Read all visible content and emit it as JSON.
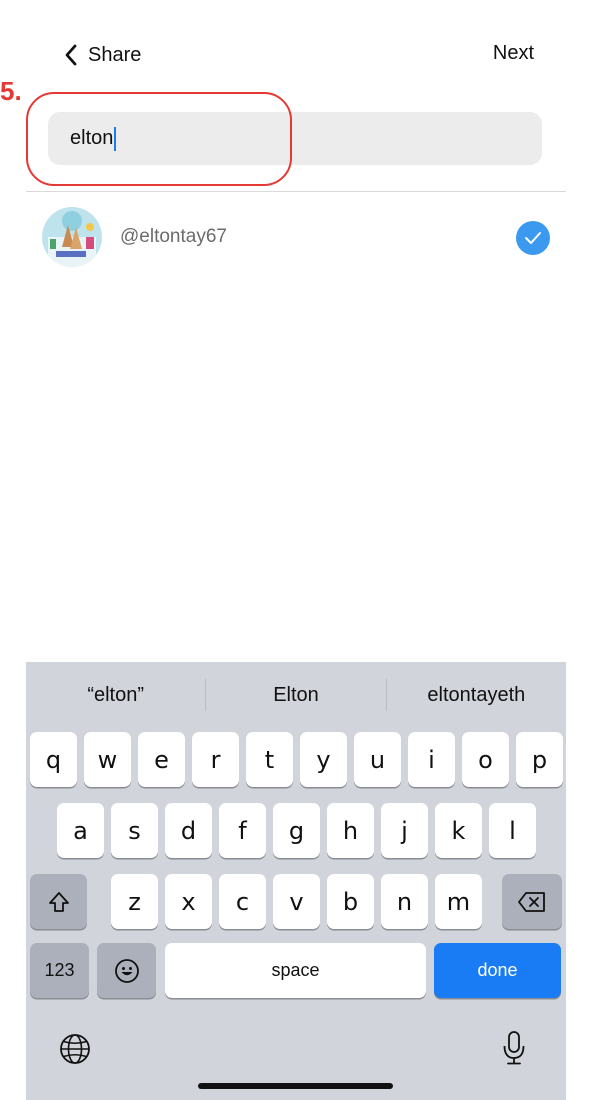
{
  "annotation": {
    "step_label": "5."
  },
  "nav": {
    "back_label": "Share",
    "next_label": "Next"
  },
  "search": {
    "value": "elton"
  },
  "results": [
    {
      "handle": "@eltontay67",
      "selected": true
    }
  ],
  "keyboard": {
    "suggestions": [
      "“elton”",
      "Elton",
      "eltontayeth"
    ],
    "row1": [
      "q",
      "w",
      "e",
      "r",
      "t",
      "y",
      "u",
      "i",
      "o",
      "p"
    ],
    "row2": [
      "a",
      "s",
      "d",
      "f",
      "g",
      "h",
      "j",
      "k",
      "l"
    ],
    "row3": [
      "z",
      "x",
      "c",
      "v",
      "b",
      "n",
      "m"
    ],
    "numbers_key": "123",
    "space_key": "space",
    "done_key": "done"
  },
  "colors": {
    "accent": "#1a7cf5",
    "annotation": "#e53935",
    "check": "#3b99f0"
  }
}
